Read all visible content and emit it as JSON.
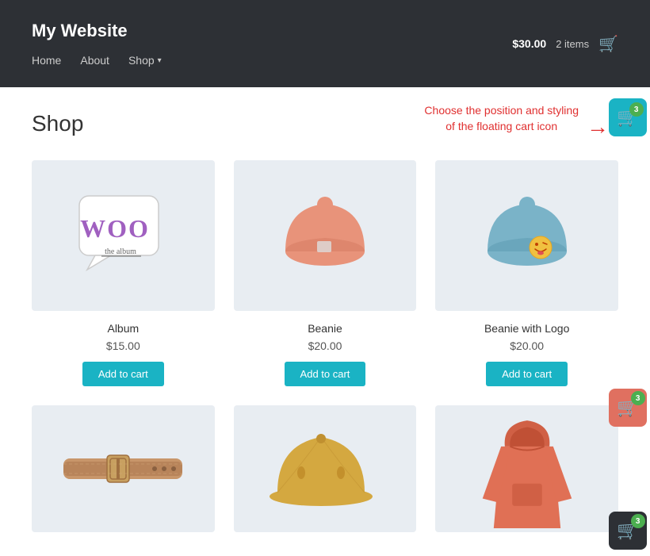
{
  "site": {
    "title": "My Website"
  },
  "nav": {
    "home": "Home",
    "about": "About",
    "shop": "Shop"
  },
  "header_cart": {
    "total": "$30.00",
    "items": "2 items"
  },
  "page": {
    "title": "Shop"
  },
  "annotation": {
    "text1": "Choose the position and styling",
    "text2": "of the floating cart icon"
  },
  "floating_carts": {
    "badge_count": "3"
  },
  "products": [
    {
      "name": "Album",
      "price": "$15.00",
      "add_to_cart": "Add to cart",
      "type": "album"
    },
    {
      "name": "Beanie",
      "price": "$20.00",
      "add_to_cart": "Add to cart",
      "type": "beanie-red"
    },
    {
      "name": "Beanie with Logo",
      "price": "$20.00",
      "add_to_cart": "Add to cart",
      "type": "beanie-blue"
    },
    {
      "name": "Belt",
      "price": "",
      "add_to_cart": "",
      "type": "belt"
    },
    {
      "name": "Cap",
      "price": "",
      "add_to_cart": "",
      "type": "cap"
    },
    {
      "name": "Hoodie",
      "price": "",
      "add_to_cart": "",
      "type": "hoodie"
    }
  ]
}
